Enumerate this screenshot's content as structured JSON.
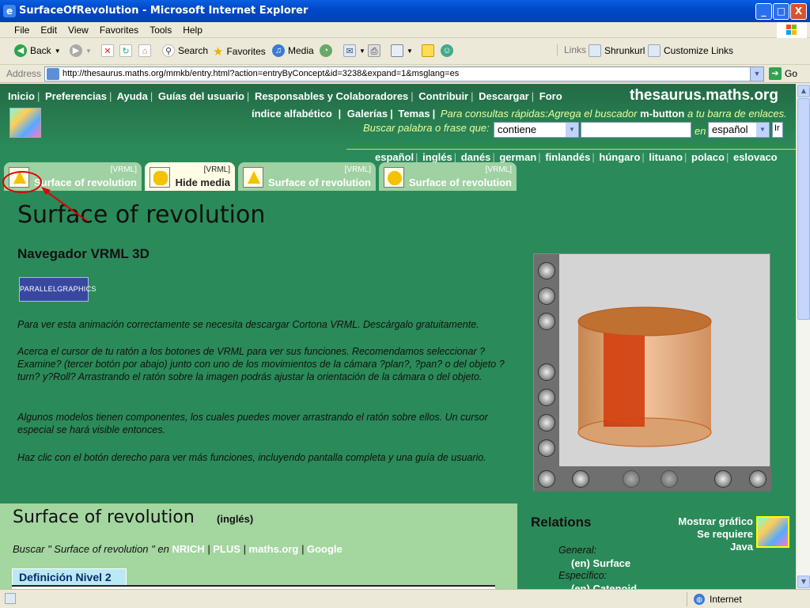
{
  "window": {
    "title": "SurfaceOfRevolution - Microsoft Internet Explorer",
    "controls": {
      "minimize": "_",
      "maximize": "□",
      "close": "X"
    }
  },
  "menu": [
    "File",
    "Edit",
    "View",
    "Favorites",
    "Tools",
    "Help"
  ],
  "toolbar": {
    "back": "Back",
    "search": "Search",
    "favorites": "Favorites",
    "media": "Media",
    "links_label": "Links",
    "shrunkurl": "Shrunkurl",
    "customize_links": "Customize Links"
  },
  "address": {
    "label": "Address",
    "url": "http://thesaurus.maths.org/mmkb/entry.html?action=entryByConcept&id=3238&expand=1&msglang=es",
    "go": "Go"
  },
  "site": {
    "name": "thesaurus.maths.org",
    "nav": [
      "Inicio",
      "Preferencias",
      "Ayuda",
      "Guías del usuario",
      "Responsables y Colaboradores",
      "Contribuir",
      "Descargar",
      "Foro"
    ],
    "nav2": [
      "índice alfabético",
      "Galerías",
      "Temas"
    ],
    "quick_tip_pre": "Para consultas rápidas:Agrega el buscador",
    "quick_tip_btn": "m-button",
    "quick_tip_post": "a tu barra de enlaces.",
    "search_label": "Buscar palabra o frase que",
    "search_mode": "contiene",
    "search_value": "",
    "search_in": "en",
    "search_lang": "español",
    "search_button": "Ir"
  },
  "languages": [
    "español",
    "inglés",
    "danés",
    "german",
    "finlandés",
    "húngaro",
    "lituano",
    "polaco",
    "eslovaco"
  ],
  "tabs": [
    {
      "top": "[VRML]",
      "label": "Surface of revolution",
      "icon": "cone-icon",
      "active": false
    },
    {
      "top": "[VRML]",
      "label": "Hide media",
      "icon": "cylinder-icon",
      "active": true
    },
    {
      "top": "[VRML]",
      "label": "Surface of revolution",
      "icon": "cone-icon",
      "active": false
    },
    {
      "top": "[VRML]",
      "label": "Surface of revolution",
      "icon": "sphere-icon",
      "active": false
    }
  ],
  "main": {
    "title": "Surface of revolution",
    "subtitle": "Navegador VRML 3D",
    "badge": "PARALLELGRAPHICS",
    "p1": "Para ver esta animación correctamente se necesita descargar Cortona VRML. Descárgalo gratuitamente.",
    "p2": "Acerca el cursor de tu ratón a los botones de VRML para ver sus funciones. Recomendamos seleccionar ? Examine? (tercer botón por abajo) junto con uno de los movimientos de la cámara ?plan?, ?pan? o del objeto ?turn? y?Roll? Arrastrando el ratón sobre la imagen podrás ajustar la orientación de la cámara o del objeto.",
    "p3": "Algunos modelos tienen componentes, los cuales puedes mover arrastrando el ratón sobre ellos. Un cursor especial se hará visible entonces.",
    "p4": "Haz clic con el botón derecho para ver más funciones, incluyendo pantalla completa y una guía de usuario."
  },
  "bottom": {
    "title": "Surface of revolution",
    "lang_tag": "(inglés)",
    "search_pre": "Buscar \" Surface of revolution \" en",
    "search_links": [
      "NRICH",
      "PLUS",
      "maths.org",
      "Google"
    ],
    "definition_tab": "Definición Nivel 2",
    "relations_title": "Relations",
    "general_label": "General:",
    "general_item": "(en) Surface",
    "specific_label": "Específico:",
    "specific_item": "(en) Catenoid",
    "graph_text": "Mostrar gráfico Se requiere Java"
  },
  "status": {
    "zone": "Internet",
    "text": ""
  },
  "colors": {
    "page_bg": "#2b8a59",
    "accent_yellow": "#e8ff9c",
    "annotation": "#e00000"
  }
}
